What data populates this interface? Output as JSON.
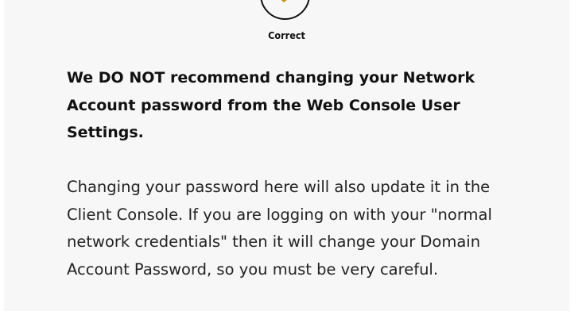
{
  "status": {
    "label": "Correct",
    "icon": "checkmark-icon",
    "icon_color": "#c4900f"
  },
  "content": {
    "warning_text": "We DO NOT recommend changing your Network Account password from the Web Console User Settings.",
    "explanation_text": "Changing your password here will also update it in the Client Console. If you are logging on with your \"normal network credentials\" then it will change your Domain Account Password, so you must be very careful."
  }
}
